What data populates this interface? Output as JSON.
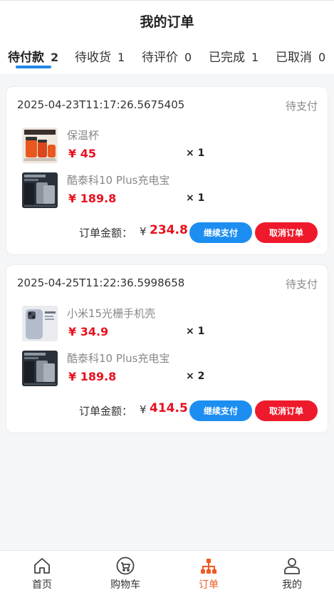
{
  "header": {
    "title": "我的订单"
  },
  "tabs": [
    {
      "label": "待付款",
      "count": "2",
      "active": true
    },
    {
      "label": "待收货",
      "count": "1"
    },
    {
      "label": "待评价",
      "count": "0"
    },
    {
      "label": "已完成",
      "count": "1"
    },
    {
      "label": "已取消",
      "count": "0"
    }
  ],
  "orders": [
    {
      "time": "2025-04-23T11:17:26.5675405",
      "status": "待支付",
      "items": [
        {
          "name": "保温杯",
          "price": "¥ 45",
          "qty": "× 1"
        },
        {
          "name": "酷泰科10 Plus充电宝",
          "price": "¥ 189.8",
          "qty": "× 1"
        }
      ],
      "total_label": "订单金额：",
      "currency": "¥",
      "total": "234.8",
      "pay_label": "继续支付",
      "cancel_label": "取消订单"
    },
    {
      "time": "2025-04-25T11:22:36.5998658",
      "status": "待支付",
      "items": [
        {
          "name": "小米15光栅手机壳",
          "price": "¥ 34.9",
          "qty": "× 1"
        },
        {
          "name": "酷泰科10 Plus充电宝",
          "price": "¥ 189.8",
          "qty": "× 2"
        }
      ],
      "total_label": "订单金额：",
      "currency": "¥",
      "total": "414.5",
      "pay_label": "继续支付",
      "cancel_label": "取消订单"
    }
  ],
  "tabbar": [
    {
      "label": "首页",
      "icon": "home-icon"
    },
    {
      "label": "购物车",
      "icon": "cart-icon"
    },
    {
      "label": "订单",
      "icon": "order-icon",
      "active": true
    },
    {
      "label": "我的",
      "icon": "user-icon"
    }
  ],
  "colors": {
    "accent": "#1e88e5",
    "price": "#e8101e",
    "active_tab": "#f05a22"
  }
}
